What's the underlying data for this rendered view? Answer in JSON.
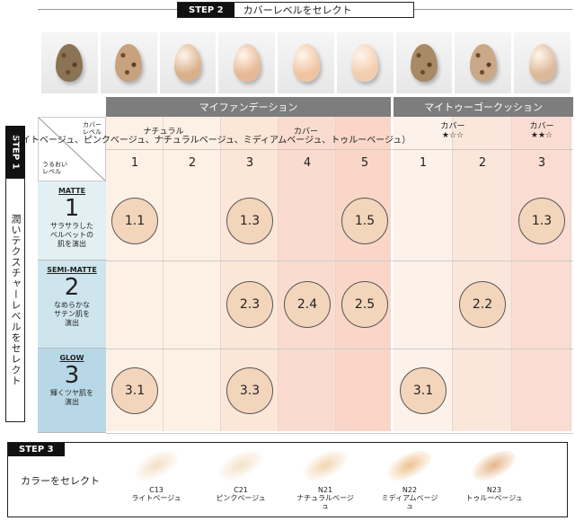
{
  "step2": {
    "label": "STEP 2",
    "title": "カバーレベルをセレクト"
  },
  "eggs": [
    {
      "color": "#8b7355"
    },
    {
      "color": "#c7a27e"
    },
    {
      "color": "#d9b08a"
    },
    {
      "color": "#e7b896"
    },
    {
      "color": "#f0c4a0"
    },
    {
      "color": "#f3cdae"
    },
    {
      "color": "#a88a66"
    },
    {
      "color": "#c9a987"
    },
    {
      "color": "#ddb898"
    }
  ],
  "step1": {
    "label": "STEP 1",
    "title": "潤いテクスチャーレベルをセレクト"
  },
  "table": {
    "foundation_header": "マイファンデーション",
    "cushion_header": "マイトゥーゴークッション",
    "corner_cover": "カバー\nレベル",
    "corner_moist": "うるおい\nレベル",
    "natural": "ナチュラル",
    "cover": "カバー",
    "cushion_cover1": "カバー\n★☆☆",
    "cushion_cover2": "カバー\n★★☆",
    "foundation_nums": [
      "1",
      "2",
      "3",
      "4",
      "5"
    ],
    "cushion_nums": [
      "1",
      "2",
      "3"
    ],
    "band_text": "（ライトベージュ、ピンクベージュ、ナチュラルベージュ、ミディアムベージュ、トゥルーベージュ）",
    "rows": [
      {
        "tag": "MATTE",
        "num": "1",
        "desc": "サラサラした\nベルベットの\n肌を演出"
      },
      {
        "tag": "SEMI-MATTE",
        "num": "2",
        "desc": "なめらかな\nサテン肌を\n演出"
      },
      {
        "tag": "GLOW",
        "num": "3",
        "desc": "輝くツヤ肌を\n演出"
      }
    ],
    "cells": [
      "1.1",
      "1.3",
      "1.5",
      "1.3",
      "2.3",
      "2.4",
      "2.5",
      "2.2",
      "3.1",
      "3.3",
      "3.1"
    ]
  },
  "step3": {
    "label": "STEP 3",
    "title": "カラーをセレクト",
    "swatches": [
      {
        "code": "C13",
        "name": "ライトベージュ",
        "color": "#f4dfc6"
      },
      {
        "code": "C21",
        "name": "ピンクベージュ",
        "color": "#f2e2c8"
      },
      {
        "code": "N21",
        "name": "ナチュラルベージュ",
        "color": "#f2d4b0"
      },
      {
        "code": "N22",
        "name": "ミディアムベージュ",
        "color": "#edc28e"
      },
      {
        "code": "N23",
        "name": "トゥルーベージュ",
        "color": "#e5b588"
      }
    ]
  }
}
